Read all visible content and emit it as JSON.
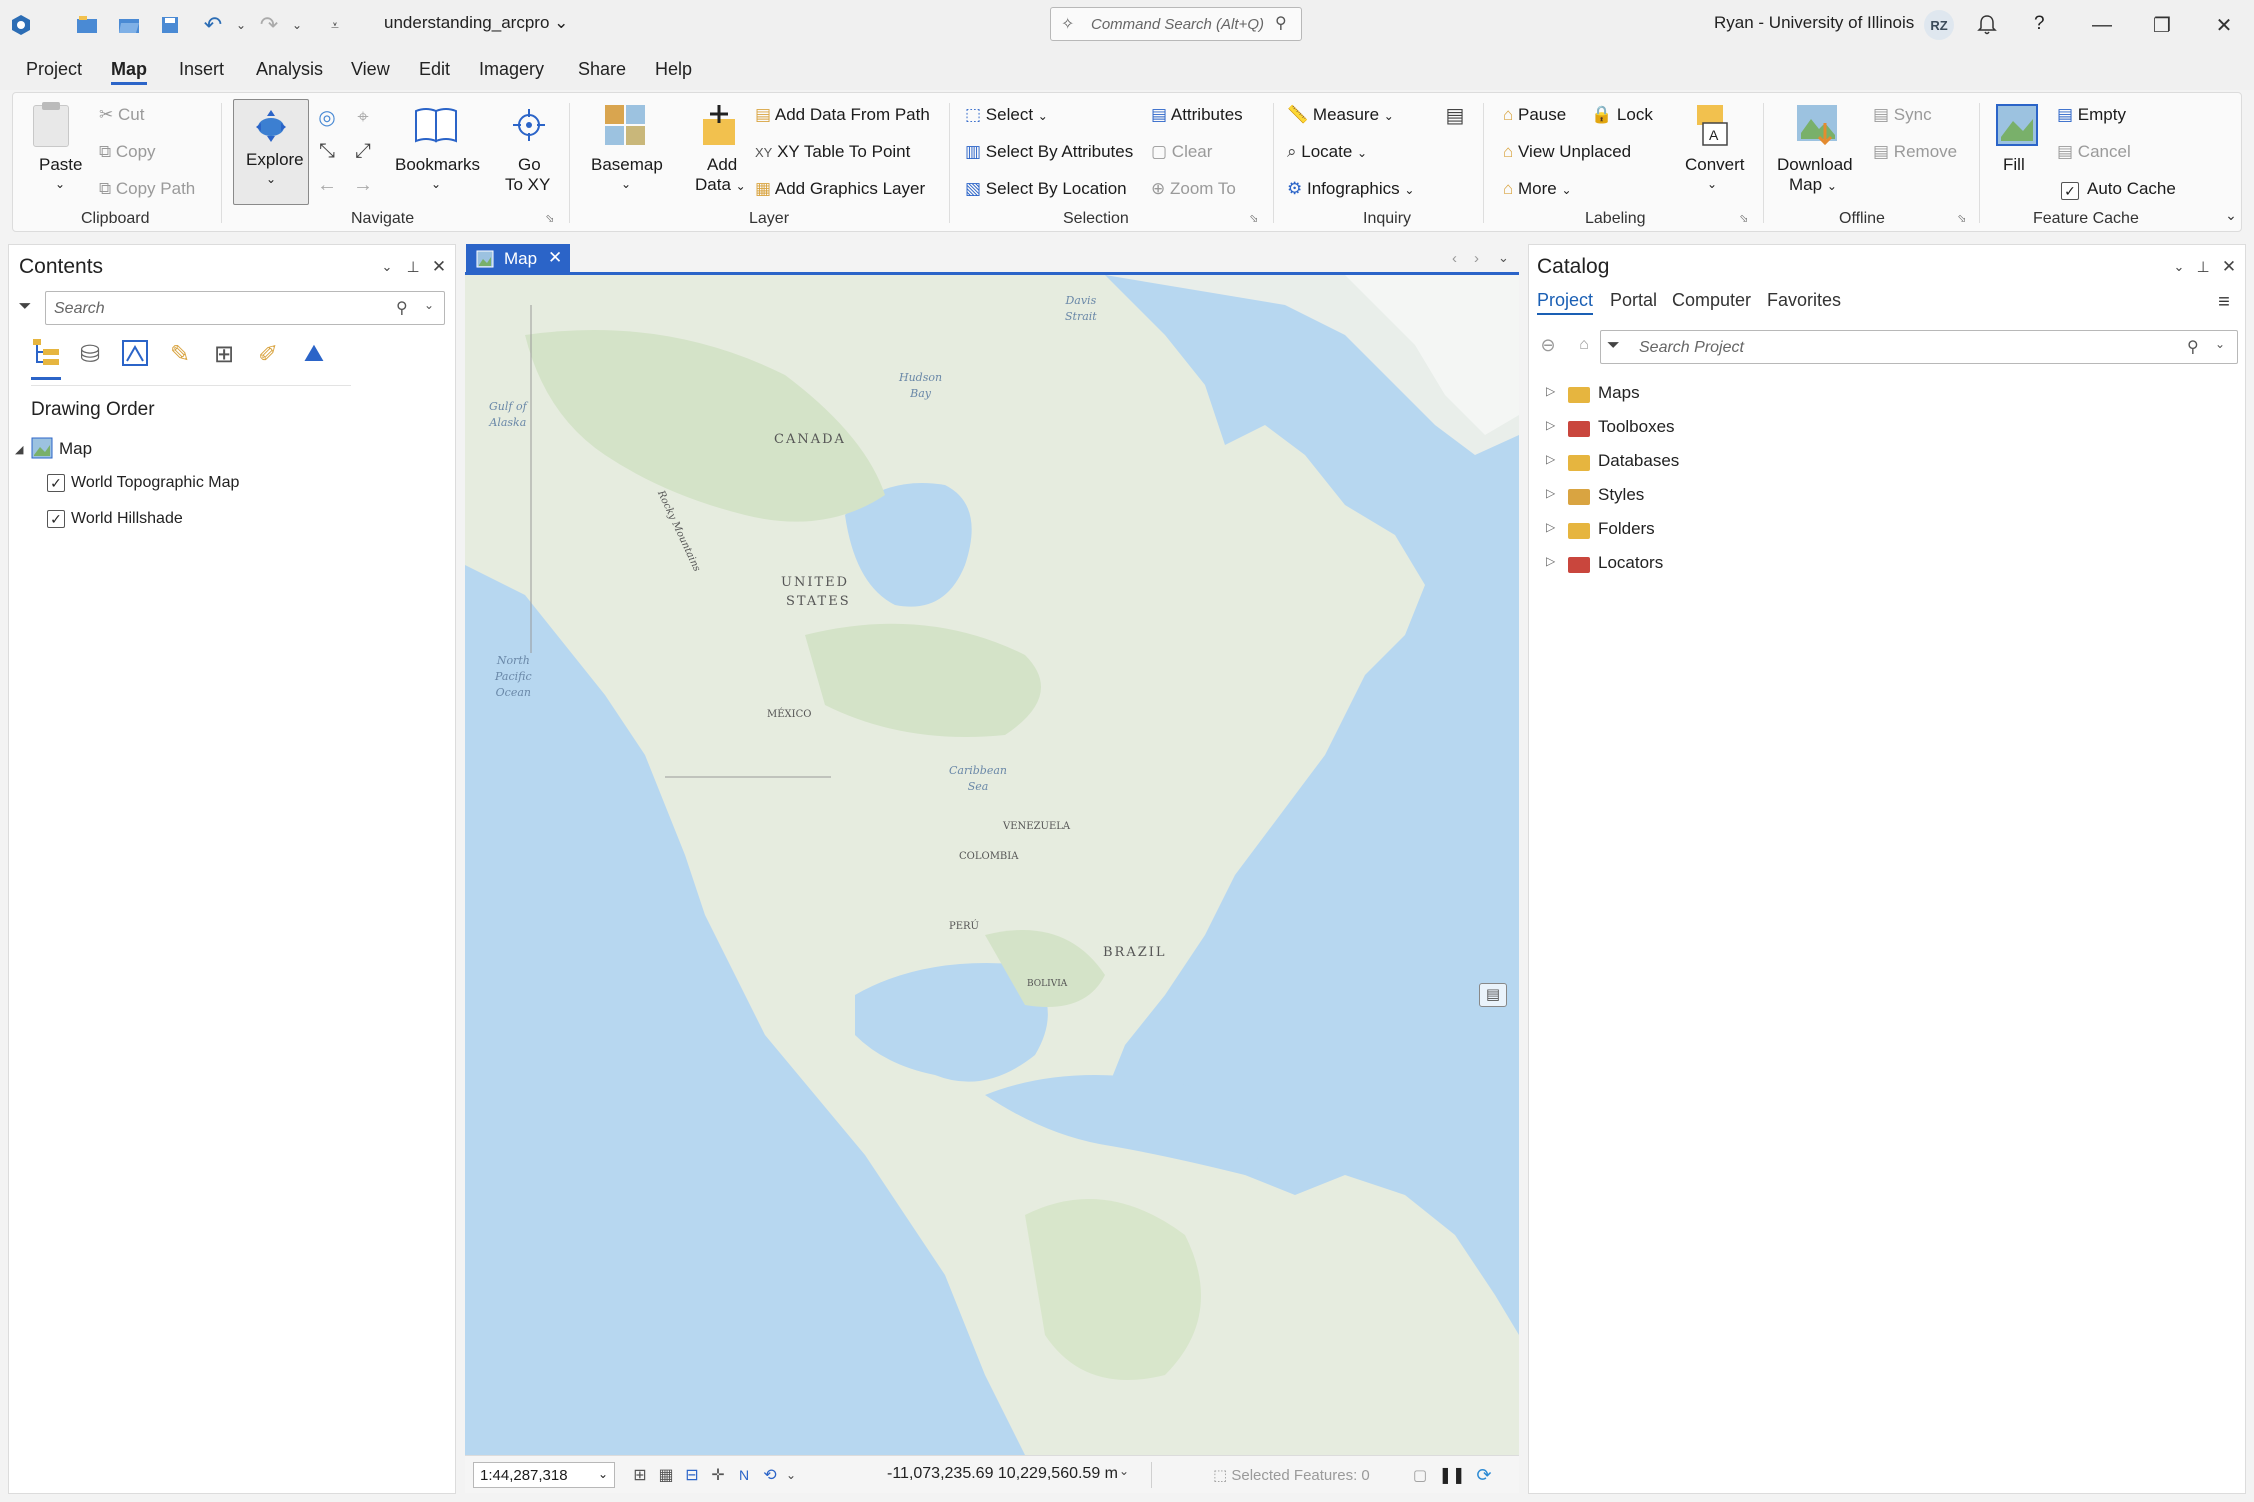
{
  "window": {
    "project_name": "understanding_arcpro",
    "command_search_placeholder": "Command Search (Alt+Q)",
    "user": "Ryan - University of Illinois",
    "user_initials": "RZ",
    "help_glyph": "?",
    "minimize_glyph": "—",
    "restore_glyph": "❐",
    "close_glyph": "✕"
  },
  "menu": [
    "Project",
    "Map",
    "Insert",
    "Analysis",
    "View",
    "Edit",
    "Imagery",
    "Share",
    "Help"
  ],
  "ribbon": {
    "clipboard": {
      "paste": "Paste",
      "cut": "Cut",
      "copy": "Copy",
      "copy_path": "Copy Path",
      "label": "Clipboard"
    },
    "navigate": {
      "explore": "Explore",
      "bookmarks": "Bookmarks",
      "go_to_xy_1": "Go",
      "go_to_xy_2": "To XY",
      "label": "Navigate"
    },
    "layer": {
      "basemap": "Basemap",
      "add_data_1": "Add",
      "add_data_2": "Data",
      "add_data_from_path": "Add Data From Path",
      "xy_table_to_point": "XY Table To Point",
      "add_graphics_layer": "Add Graphics Layer",
      "label": "Layer"
    },
    "selection": {
      "select": "Select",
      "select_by_attributes": "Select By Attributes",
      "select_by_location": "Select By Location",
      "attributes": "Attributes",
      "clear": "Clear",
      "zoom_to": "Zoom To",
      "label": "Selection"
    },
    "inquiry": {
      "measure": "Measure",
      "locate": "Locate",
      "infographics": "Infographics",
      "label": "Inquiry"
    },
    "labeling": {
      "pause": "Pause",
      "lock": "Lock",
      "view_unplaced": "View Unplaced",
      "more": "More",
      "convert": "Convert",
      "label": "Labeling"
    },
    "offline": {
      "download_map_1": "Download",
      "download_map_2": "Map",
      "sync": "Sync",
      "remove": "Remove",
      "label": "Offline"
    },
    "feature_cache": {
      "fill": "Fill",
      "empty": "Empty",
      "cancel": "Cancel",
      "auto_cache": "Auto Cache",
      "label": "Feature Cache"
    }
  },
  "contents": {
    "title": "Contents",
    "search_placeholder": "Search",
    "section": "Drawing Order",
    "map_name": "Map",
    "layers": [
      {
        "name": "World Topographic Map",
        "checked": true
      },
      {
        "name": "World Hillshade",
        "checked": true
      }
    ]
  },
  "map_tab": {
    "label": "Map"
  },
  "map_labels": {
    "canada": "CANADA",
    "united_states_1": "UNITED",
    "united_states_2": "STATES",
    "mexico": "MÉXICO",
    "venezuela": "VENEZUELA",
    "colombia": "COLOMBIA",
    "peru": "PERÚ",
    "brazil": "BRAZIL",
    "bolivia": "BOLIVIA",
    "hudson_bay_1": "Hudson",
    "hudson_bay_2": "Bay",
    "gulf_alaska_1": "Gulf of",
    "gulf_alaska_2": "Alaska",
    "davis_strait_1": "Davis",
    "davis_strait_2": "Strait",
    "npo_1": "North",
    "npo_2": "Pacific",
    "npo_3": "Ocean",
    "caribbean_1": "Caribbean",
    "caribbean_2": "Sea",
    "rocky": "Rocky Mountains"
  },
  "status": {
    "scale": "1:44,287,318",
    "coordinates": "-11,073,235.69 10,229,560.59 m",
    "selected_features": "Selected Features: 0"
  },
  "catalog": {
    "title": "Catalog",
    "tabs": [
      "Project",
      "Portal",
      "Computer",
      "Favorites"
    ],
    "search_placeholder": "Search Project",
    "items": [
      {
        "name": "Maps",
        "color": "#e6b53f"
      },
      {
        "name": "Toolboxes",
        "color": "#c9463d"
      },
      {
        "name": "Databases",
        "color": "#e6b53f"
      },
      {
        "name": "Styles",
        "color": "#d9a441"
      },
      {
        "name": "Folders",
        "color": "#e6b53f"
      },
      {
        "name": "Locators",
        "color": "#c9463d"
      }
    ]
  }
}
